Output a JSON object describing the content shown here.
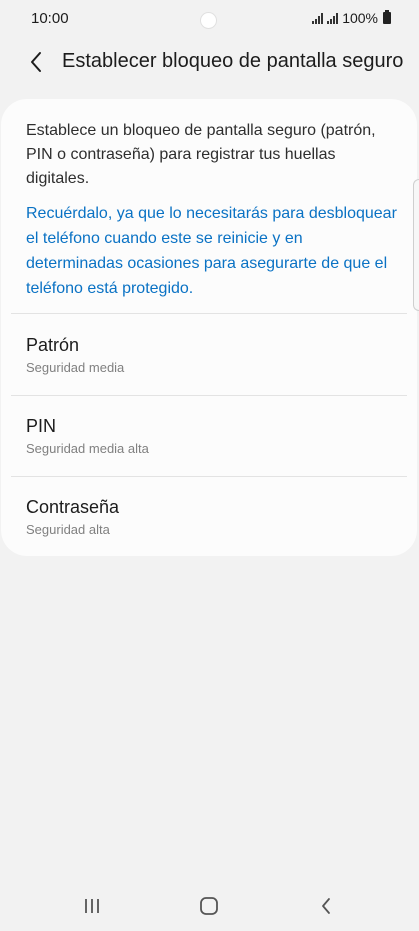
{
  "status_bar": {
    "time": "10:00",
    "battery": "100%",
    "icons": [
      "signal-icon",
      "signal-icon",
      "battery-icon"
    ]
  },
  "header": {
    "back_icon": "chevron-left-icon",
    "title": "Establecer bloqueo de pantalla seguro"
  },
  "main": {
    "description": "Establece un bloqueo de pantalla seguro (patrón, PIN o contraseña) para registrar tus huellas digitales.",
    "notice": "Recuérdalo, ya que lo necesitarás para desbloquear el teléfono cuando este se reinicie y en determinadas ocasiones para asegurarte de que el teléfono está protegido.",
    "options": [
      {
        "title": "Patrón",
        "subtitle": "Seguridad media"
      },
      {
        "title": "PIN",
        "subtitle": "Seguridad media alta"
      },
      {
        "title": "Contraseña",
        "subtitle": "Seguridad alta"
      }
    ]
  },
  "nav_bar": {
    "icons": [
      "recent-apps-icon",
      "home-icon",
      "back-icon"
    ]
  },
  "colors": {
    "background": "#f2f2f2",
    "card": "#fcfcfc",
    "accent_link": "#0a72c4",
    "text_primary": "#1c1c1c",
    "text_secondary": "#808080"
  }
}
